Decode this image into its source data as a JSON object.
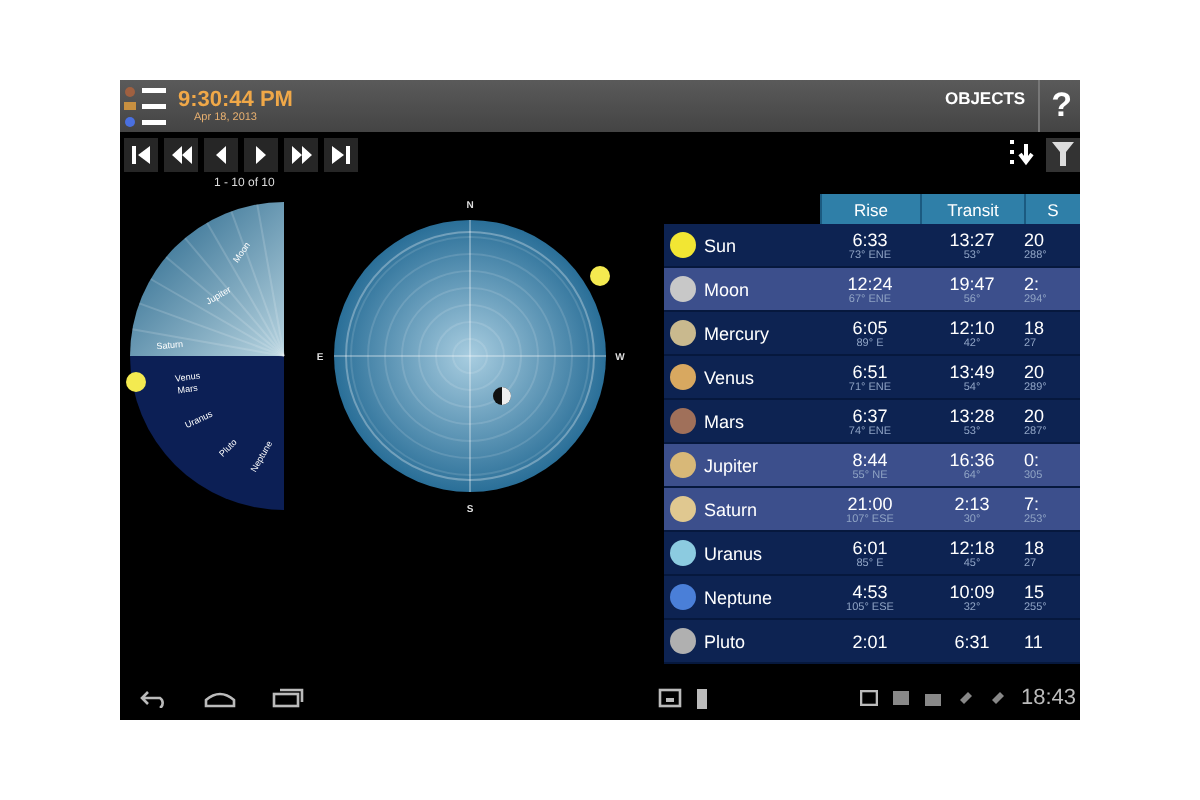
{
  "top_bar": {
    "time": "9:30:44 PM",
    "date": "Apr 18, 2013",
    "title": "OBJECTS",
    "help": "?"
  },
  "pager": "1 - 10 of 10",
  "sky_chart": {
    "compass": [
      "N",
      "E",
      "S",
      "W"
    ],
    "arc_labels": [
      "Moon",
      "Jupiter",
      "Saturn",
      "Venus",
      "Mars",
      "Uranus",
      "Pluto",
      "Neptune"
    ]
  },
  "table": {
    "columns": [
      "Rise",
      "Transit",
      "S"
    ],
    "rows": [
      {
        "name": "Sun",
        "color": "#f2e633",
        "selected": false,
        "cells": [
          [
            "6:33",
            "73° ENE"
          ],
          [
            "13:27",
            "53°"
          ],
          [
            "20",
            "288°"
          ]
        ]
      },
      {
        "name": "Moon",
        "color": "#c8c8c8",
        "selected": true,
        "cells": [
          [
            "12:24",
            "67° ENE"
          ],
          [
            "19:47",
            "56°"
          ],
          [
            "2:",
            "294°"
          ]
        ]
      },
      {
        "name": "Mercury",
        "color": "#c9b98e",
        "selected": false,
        "cells": [
          [
            "6:05",
            "89° E"
          ],
          [
            "12:10",
            "42°"
          ],
          [
            "18",
            "27"
          ]
        ]
      },
      {
        "name": "Venus",
        "color": "#d8a860",
        "selected": false,
        "cells": [
          [
            "6:51",
            "71° ENE"
          ],
          [
            "13:49",
            "54°"
          ],
          [
            "20",
            "289°"
          ]
        ]
      },
      {
        "name": "Mars",
        "color": "#a0705a",
        "selected": false,
        "cells": [
          [
            "6:37",
            "74° ENE"
          ],
          [
            "13:28",
            "53°"
          ],
          [
            "20",
            "287°"
          ]
        ]
      },
      {
        "name": "Jupiter",
        "color": "#d8b878",
        "selected": true,
        "cells": [
          [
            "8:44",
            "55° NE"
          ],
          [
            "16:36",
            "64°"
          ],
          [
            "0:",
            "305"
          ]
        ]
      },
      {
        "name": "Saturn",
        "color": "#e0c890",
        "selected": true,
        "cells": [
          [
            "21:00",
            "107° ESE"
          ],
          [
            "2:13",
            "30°"
          ],
          [
            "7:",
            "253°"
          ]
        ]
      },
      {
        "name": "Uranus",
        "color": "#8ccbe0",
        "selected": false,
        "cells": [
          [
            "6:01",
            "85° E"
          ],
          [
            "12:18",
            "45°"
          ],
          [
            "18",
            "27"
          ]
        ]
      },
      {
        "name": "Neptune",
        "color": "#4a7fd8",
        "selected": false,
        "cells": [
          [
            "4:53",
            "105° ESE"
          ],
          [
            "10:09",
            "32°"
          ],
          [
            "15",
            "255°"
          ]
        ]
      },
      {
        "name": "Pluto",
        "color": "#b0b0b0",
        "selected": false,
        "cells": [
          [
            "2:01"
          ],
          [
            "6:31"
          ],
          [
            "11"
          ]
        ]
      }
    ]
  },
  "status_bar": {
    "time": "18:43"
  }
}
